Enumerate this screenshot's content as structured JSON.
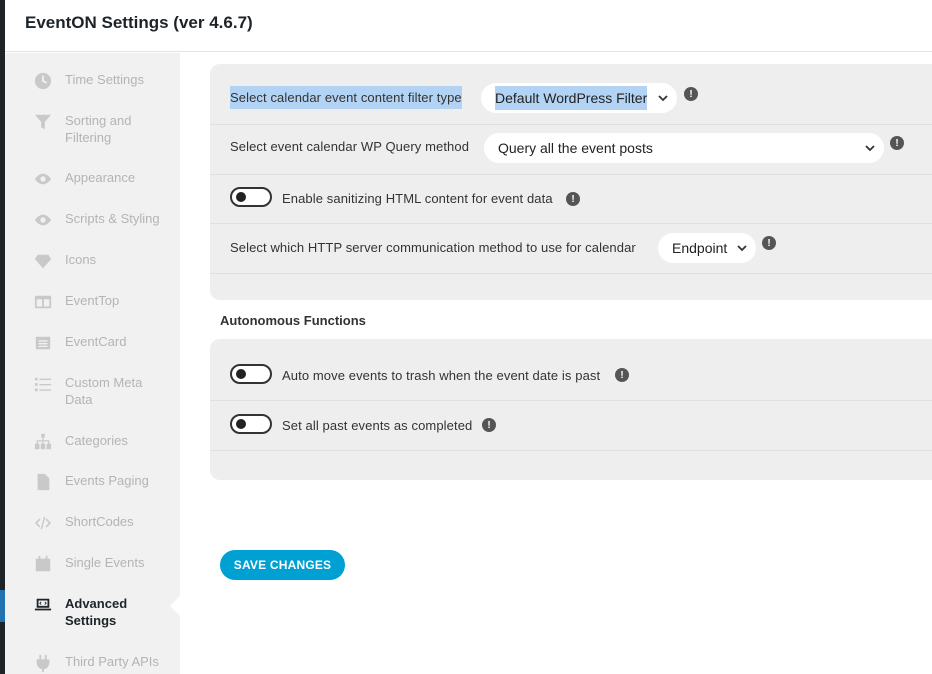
{
  "header": {
    "title": "EventON Settings (ver 4.6.7)"
  },
  "sidebar": {
    "items": [
      {
        "label": "Time Settings",
        "icon": "clock-icon"
      },
      {
        "label": "Sorting and Filtering",
        "icon": "filter-icon"
      },
      {
        "label": "Appearance",
        "icon": "eye-icon"
      },
      {
        "label": "Scripts & Styling",
        "icon": "eye-icon"
      },
      {
        "label": "Icons",
        "icon": "diamond-icon"
      },
      {
        "label": "EventTop",
        "icon": "columns-icon"
      },
      {
        "label": "EventCard",
        "icon": "card-icon"
      },
      {
        "label": "Custom Meta Data",
        "icon": "list-icon"
      },
      {
        "label": "Categories",
        "icon": "sitemap-icon"
      },
      {
        "label": "Events Paging",
        "icon": "file-icon"
      },
      {
        "label": "ShortCodes",
        "icon": "code-icon"
      },
      {
        "label": "Single Events",
        "icon": "calendar-icon"
      },
      {
        "label": "Advanced Settings",
        "icon": "laptop-code-icon",
        "active": true
      },
      {
        "label": "Third Party APIs",
        "icon": "plug-icon"
      }
    ]
  },
  "advanced": {
    "filter_type": {
      "label": "Select calendar event content filter type",
      "value": "Default WordPress Filter"
    },
    "query_method": {
      "label": "Select event calendar WP Query method",
      "value": "Query all the event posts"
    },
    "sanitize": {
      "label": "Enable sanitizing HTML content for event data"
    },
    "http_method": {
      "label": "Select which HTTP server communication method to use for calendar",
      "value": "Endpoint"
    }
  },
  "autonomous": {
    "title": "Autonomous Functions",
    "trash": {
      "label": "Auto move events to trash when the event date is past"
    },
    "completed": {
      "label": "Set all past events as completed"
    }
  },
  "info_glyph": "!",
  "save_label": "SAVE CHANGES"
}
